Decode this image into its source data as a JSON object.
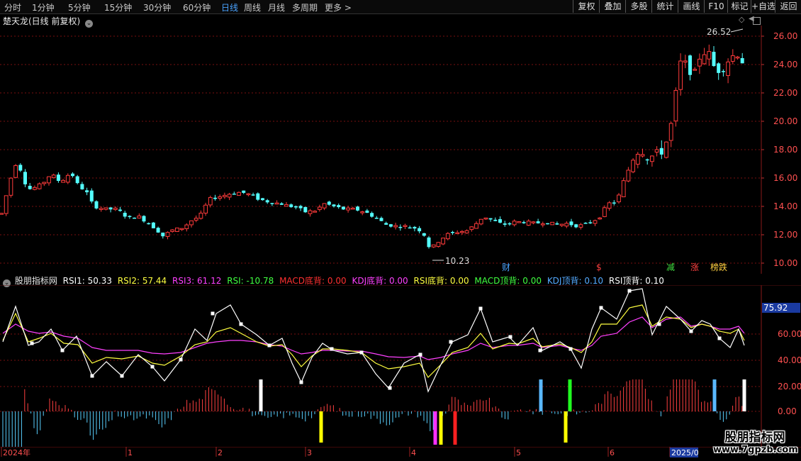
{
  "toolbar": {
    "timeframes": [
      {
        "label": "分时",
        "active": false
      },
      {
        "label": "1分钟",
        "active": false
      },
      {
        "label": "5分钟",
        "active": false
      },
      {
        "label": "15分钟",
        "active": false
      },
      {
        "label": "30分钟",
        "active": false
      },
      {
        "label": "60分钟",
        "active": false
      },
      {
        "label": "日线",
        "active": true
      },
      {
        "label": "周线",
        "active": false
      },
      {
        "label": "月线",
        "active": false
      },
      {
        "label": "多周期",
        "active": false
      },
      {
        "label": "更多 >",
        "active": false
      }
    ],
    "right_buttons": [
      "复权",
      "叠加",
      "多股",
      "统计",
      "画线",
      "F10",
      "标记",
      "+自选",
      "返回"
    ]
  },
  "main_chart": {
    "title": "楚天龙(日线 前复权)",
    "y_ticks": [
      "26.00",
      "24.00",
      "22.00",
      "20.00",
      "18.00",
      "16.00",
      "14.00",
      "12.00",
      "10.00"
    ],
    "high_label": "26.52",
    "low_label": "10.23",
    "markers": [
      {
        "text": "财",
        "color": "#4aa3ff"
      },
      {
        "text": "$",
        "color": "#ff4040"
      },
      {
        "text": "减",
        "color": "#40e040"
      },
      {
        "text": "涨",
        "color": "#ff4040"
      },
      {
        "text": "榜跌",
        "color": "#ffd040"
      }
    ],
    "colors": {
      "up": "#ff3b3b",
      "down": "#54ffff",
      "grid": "#7a1010"
    }
  },
  "indicator": {
    "name": "股朋指标网",
    "values": [
      {
        "label": "RSI1: 50.33",
        "color": "#ffffff"
      },
      {
        "label": "RSI2: 57.44",
        "color": "#ffff40"
      },
      {
        "label": "RSI3: 61.12",
        "color": "#ff40ff"
      },
      {
        "label": "RSI: -10.78",
        "color": "#40ff40"
      },
      {
        "label": "MACD底背: 0.00",
        "color": "#ff3030"
      },
      {
        "label": "KDJ底背: 0.00",
        "color": "#ff40ff"
      },
      {
        "label": "RSI底背: 0.00",
        "color": "#ffff40"
      },
      {
        "label": "MACD顶背: 0.00",
        "color": "#40ff40"
      },
      {
        "label": "KDJ顶背: 0.10",
        "color": "#54aaff"
      },
      {
        "label": "RSI顶背: 0.10",
        "color": "#ffffff"
      }
    ],
    "y_ticks": [
      "60.00",
      "40.00",
      "20.00",
      "0.00"
    ],
    "current_value": "75.92"
  },
  "time_axis": {
    "labels": [
      "2024年",
      "1",
      "2",
      "3",
      "4",
      "5",
      "6",
      "2025/0"
    ]
  },
  "watermark": {
    "title": "股朋指标网",
    "url": "www.7gpzb.com"
  }
}
